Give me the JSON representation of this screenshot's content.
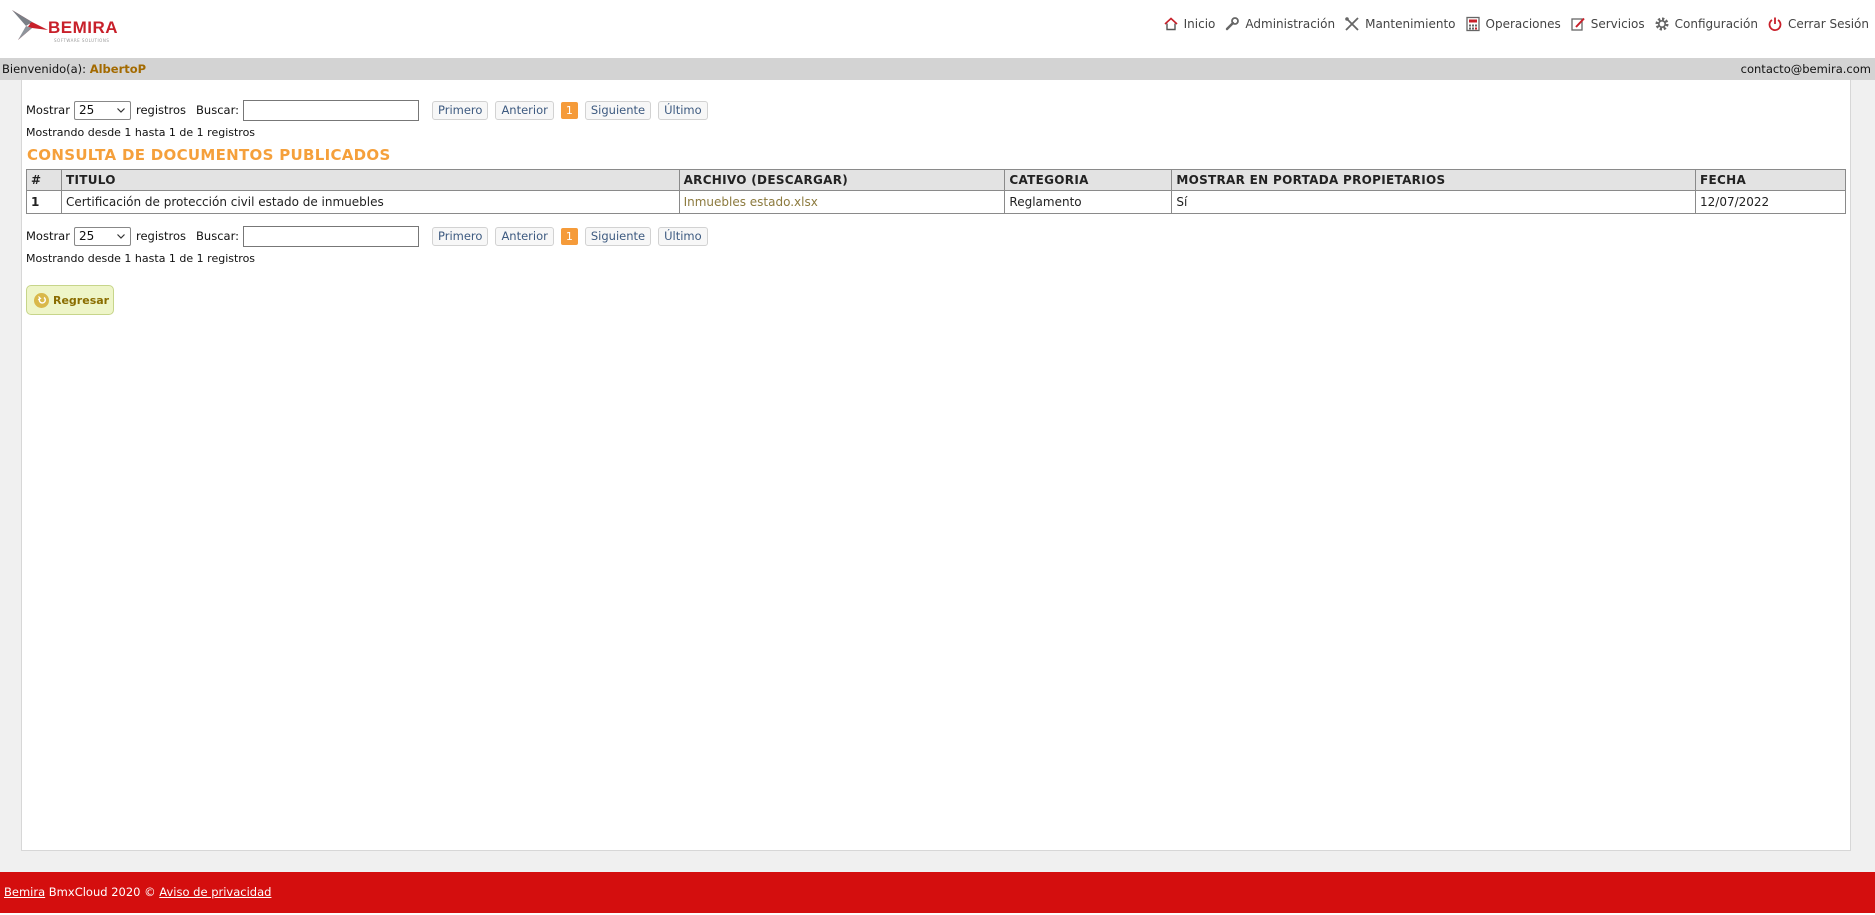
{
  "brand": {
    "name": "BEMIRA",
    "tagline": "SOFTWARE SOLUTIONS"
  },
  "nav": [
    {
      "label": "Inicio",
      "icon": "home-icon"
    },
    {
      "label": "Administración",
      "icon": "wrench-icon"
    },
    {
      "label": "Mantenimiento",
      "icon": "tools-icon"
    },
    {
      "label": "Operaciones",
      "icon": "calculator-icon"
    },
    {
      "label": "Servicios",
      "icon": "edit-icon"
    },
    {
      "label": "Configuración",
      "icon": "gear-icon"
    },
    {
      "label": "Cerrar Sesión",
      "icon": "power-icon"
    }
  ],
  "welcome": {
    "prefix": "Bienvenido(a): ",
    "user": "AlbertoP",
    "email": "contacto@bemira.com"
  },
  "controls": {
    "show_label": "Mostrar",
    "page_size": "25",
    "records_label": "registros",
    "search_label": "Buscar:",
    "search_value": "",
    "first": "Primero",
    "previous": "Anterior",
    "current_page": "1",
    "next": "Siguiente",
    "last": "Último",
    "info": "Mostrando desde 1 hasta 1 de 1 registros"
  },
  "page_title": "CONSULTA DE DOCUMENTOS PUBLICADOS",
  "table": {
    "headers": [
      "#",
      "TITULO",
      "ARCHIVO (DESCARGAR)",
      "CATEGORIA",
      "MOSTRAR EN PORTADA PROPIETARIOS",
      "FECHA"
    ],
    "rows": [
      {
        "num": "1",
        "titulo": "Certificación de protección civil estado de inmuebles",
        "archivo": "Inmuebles estado.xlsx",
        "categoria": "Reglamento",
        "portada": "Sí",
        "fecha": "12/07/2022"
      }
    ]
  },
  "back_button": "Regresar",
  "footer": {
    "company": "Bemira",
    "text": " BmxCloud 2020 © ",
    "privacy": "Aviso de privacidad"
  },
  "colors": {
    "brand_red": "#d40e0e",
    "title_orange": "#f5a03b",
    "current_page": "#f59b3a"
  }
}
